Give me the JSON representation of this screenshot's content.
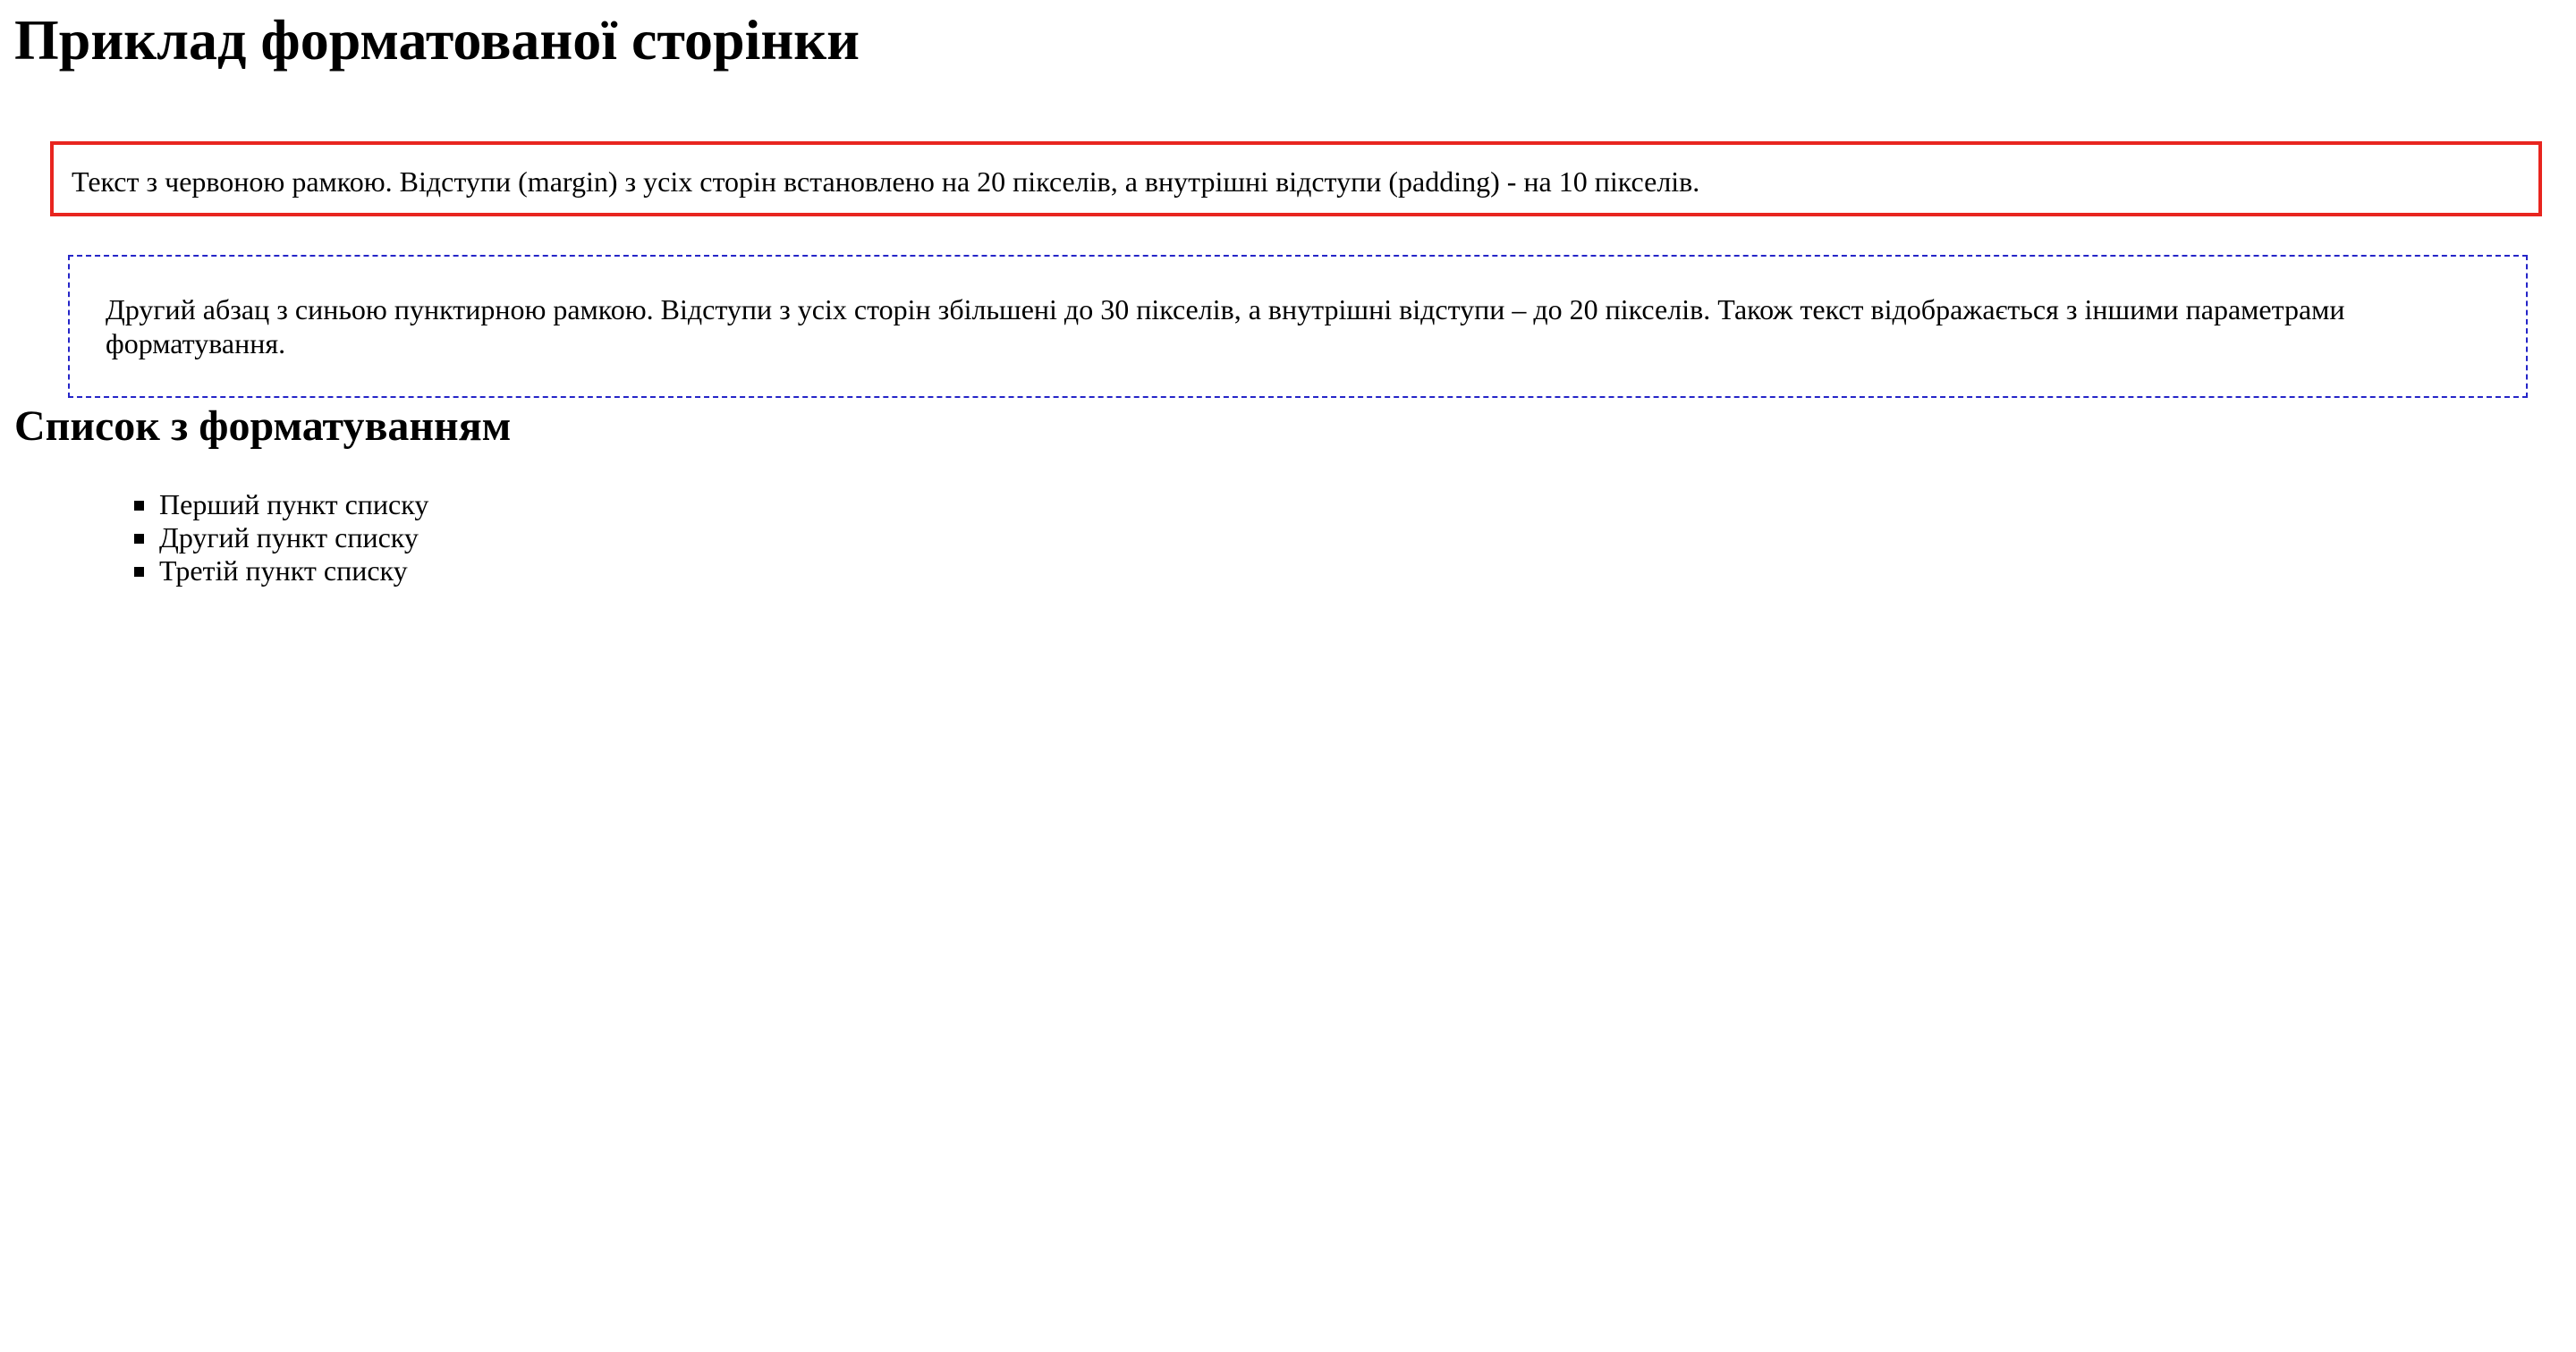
{
  "page": {
    "title": "Приклад форматованої сторінки",
    "paragraph_red": "Текст з червоною рамкою. Відступи (margin) з усіх сторін встановлено на 20 пікселів, а внутрішні відступи (padding) - на 10 пікселів.",
    "paragraph_blue": "Другий абзац з синьою пунктирною рамкою. Відступи з усіх сторін збільшені до 30 пікселів, а внутрішні відступи – до 20 пікселів. Також текст відображається з іншими параметрами форматування.",
    "list_heading": "Список з форматуванням",
    "list_items": [
      "Перший пункт списку",
      "Другий пункт списку",
      "Третій пункт списку"
    ]
  },
  "colors": {
    "red_border": "#e8251f",
    "blue_border": "#2525c8",
    "background": "#ffffff",
    "text": "#000000"
  },
  "icons": {
    "list_bullet": "square-bullet-icon"
  }
}
